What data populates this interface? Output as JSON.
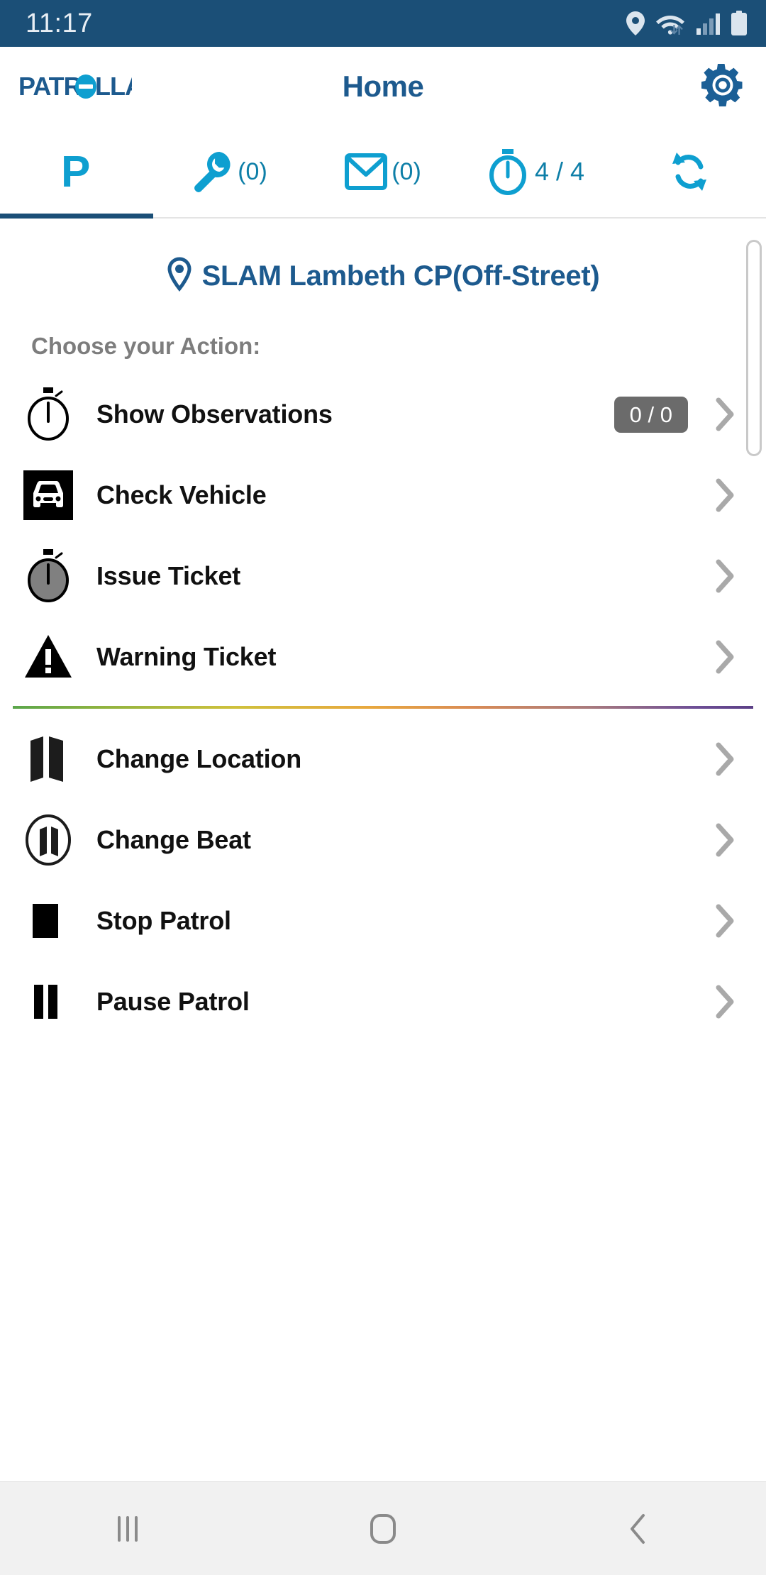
{
  "status_bar": {
    "time": "11:17",
    "icons": [
      "location-pin-icon",
      "wifi-icon",
      "cellular-signal-icon",
      "battery-icon"
    ],
    "background_color": "#1b4f77"
  },
  "app_bar": {
    "logo_text": "PATROLLA",
    "title": "Home",
    "settings_icon": "gear-icon",
    "brand_color": "#1d5a8e",
    "accent_color": "#0e9fd0"
  },
  "tabs": [
    {
      "icon": "parking-p-icon",
      "label": "",
      "active": true
    },
    {
      "icon": "wrench-icon",
      "label": "(0)",
      "active": false
    },
    {
      "icon": "envelope-icon",
      "label": "(0)",
      "active": false
    },
    {
      "icon": "stopwatch-icon",
      "label": "4 / 4",
      "active": false
    },
    {
      "icon": "sync-refresh-icon",
      "label": "",
      "active": false
    }
  ],
  "location": {
    "pin_icon": "map-pin-icon",
    "name": "SLAM Lambeth CP(Off-Street)"
  },
  "section": {
    "heading": "Choose your Action:"
  },
  "actions": [
    {
      "icon": "stopwatch-outline-icon",
      "label": "Show Observations",
      "badge": "0 / 0",
      "chevron": "chevron-right-icon"
    },
    {
      "icon": "vehicle-front-icon",
      "label": "Check Vehicle",
      "badge": "",
      "chevron": "chevron-right-icon"
    },
    {
      "icon": "stopwatch-filled-icon",
      "label": "Issue Ticket",
      "badge": "",
      "chevron": "chevron-right-icon"
    },
    {
      "icon": "warning-triangle-icon",
      "label": "Warning Ticket",
      "badge": "",
      "chevron": "chevron-right-icon"
    },
    {
      "icon": "map-fold-icon",
      "label": "Change Location",
      "badge": "",
      "chevron": "chevron-right-icon"
    },
    {
      "icon": "beat-circle-icon",
      "label": "Change Beat",
      "badge": "",
      "chevron": "chevron-right-icon"
    },
    {
      "icon": "stop-square-icon",
      "label": "Stop Patrol",
      "badge": "",
      "chevron": "chevron-right-icon"
    },
    {
      "icon": "pause-bars-icon",
      "label": "Pause Patrol",
      "badge": "",
      "chevron": "chevron-right-icon"
    }
  ],
  "divider_after_index": 3,
  "badge_color": "#6b6b6b",
  "nav_bar": {
    "recents_icon": "recents-icon",
    "home_icon": "home-icon",
    "back_icon": "back-icon",
    "background_color": "#f1f1f1"
  }
}
